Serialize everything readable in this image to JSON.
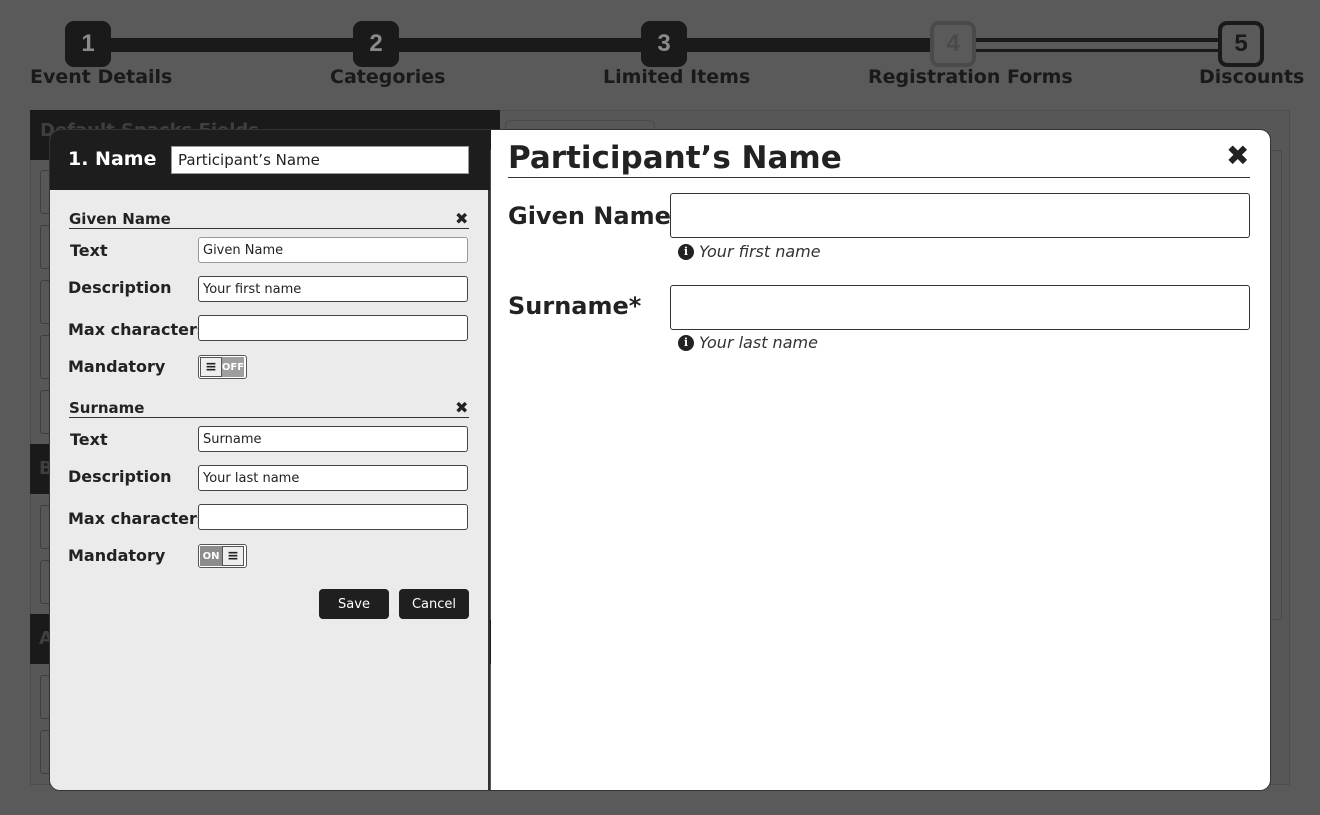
{
  "stepper": {
    "steps": [
      {
        "number": "1",
        "label": "Event Details"
      },
      {
        "number": "2",
        "label": "Categories"
      },
      {
        "number": "3",
        "label": "Limited Items"
      },
      {
        "number": "4",
        "label": "Registration Forms"
      },
      {
        "number": "5",
        "label": "Discounts"
      }
    ],
    "current_step": 4
  },
  "background": {
    "section_header": "Default Snacks Fields",
    "section_letters": [
      "B",
      "A"
    ]
  },
  "editor": {
    "title": "1. Name",
    "name_value": "Participant’s Name",
    "fields": [
      {
        "title": "Given Name",
        "text_label": "Text",
        "text_value": "Given Name",
        "description_label": "Description",
        "description_value": "Your first name",
        "max_label": "Max characters",
        "max_value": "",
        "mandatory_label": "Mandatory",
        "mandatory_state": "OFF"
      },
      {
        "title": "Surname",
        "text_label": "Text",
        "text_value": "Surname",
        "description_label": "Description",
        "description_value": "Your last name",
        "max_label": "Max characters",
        "max_value": "",
        "mandatory_label": "Mandatory",
        "mandatory_state": "ON"
      }
    ],
    "save_label": "Save",
    "cancel_label": "Cancel"
  },
  "preview": {
    "title": "Participant’s Name",
    "close_glyph": "✖",
    "fields": [
      {
        "label": "Given Name",
        "help": "Your first name"
      },
      {
        "label": "Surname*",
        "help": "Your last name"
      }
    ]
  },
  "icons": {
    "remove": "close-icon",
    "info": "info-icon",
    "toggle_grip": "grip-lines-icon"
  },
  "colors": {
    "overlay_bg": "#5a5a5a",
    "dark": "#1d1d1d",
    "editor_bg": "#ebebeb",
    "preview_bg": "#ffffff"
  }
}
